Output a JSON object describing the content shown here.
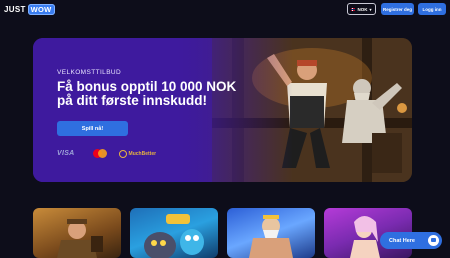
{
  "header": {
    "logo": {
      "part1": "JUST",
      "part2": "WOW"
    },
    "currency": "NOK",
    "register_label": "Registrer deg",
    "login_label": "Logg inn"
  },
  "hero": {
    "kicker": "VELKOMSTTILBUD",
    "title_line1": "Få bonus opptil 10 000  NOK",
    "title_line2": "på ditt første innskudd!",
    "cta_label": "Spill nå!",
    "payments": {
      "visa": "VISA",
      "muchbetter": "MuchBetter"
    }
  },
  "games": [
    {
      "icon": "book-of-dead-art"
    },
    {
      "icon": "monster-slot-art"
    },
    {
      "icon": "zeus-slot-art"
    },
    {
      "icon": "anime-girl-slot-art"
    }
  ],
  "chat": {
    "label": "Chat Here"
  },
  "colors": {
    "primary": "#2f6fe0",
    "background": "#0d0d1a",
    "hero": "#3f1a9e"
  }
}
